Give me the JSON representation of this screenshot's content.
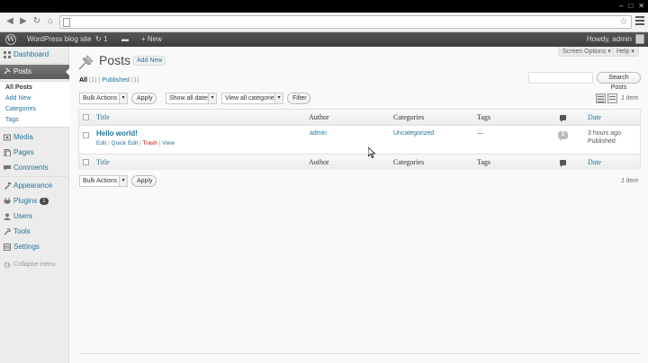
{
  "browser": {
    "back_icon": "arrow-left-icon",
    "forward_icon": "arrow-right-icon",
    "reload_icon": "reload-icon",
    "home_icon": "home-icon",
    "star_icon": "star-icon",
    "menu_icon": "hamburger-icon"
  },
  "adminbar": {
    "site_name": "WordPress blog site",
    "updates_count": "1",
    "new_label": "+ New",
    "howdy": "Howdy, admin"
  },
  "sidebar": {
    "dashboard": "Dashboard",
    "posts": "Posts",
    "submenu": {
      "all_posts": "All Posts",
      "add_new": "Add New",
      "categories": "Categories",
      "tags": "Tags"
    },
    "media": "Media",
    "pages": "Pages",
    "comments": "Comments",
    "appearance": "Appearance",
    "plugins": "Plugins",
    "plugins_badge": "1",
    "users": "Users",
    "tools": "Tools",
    "settings": "Settings",
    "collapse": "Collapse menu"
  },
  "main": {
    "screen_options": "Screen Options ▾",
    "help": "Help ▾",
    "title": "Posts",
    "add_new": "Add New",
    "filters": {
      "all": "All",
      "all_count": "(1)",
      "sep": "|",
      "published": "Published",
      "published_count": "(1)"
    },
    "search_button": "Search Posts",
    "bulk_actions": "Bulk Actions",
    "apply": "Apply",
    "all_dates": "Show all dates",
    "all_categories": "View all categories",
    "filter": "Filter",
    "items_count": "1 item"
  },
  "table": {
    "headers": {
      "title": "Title",
      "author": "Author",
      "categories": "Categories",
      "tags": "Tags",
      "date": "Date"
    },
    "rows": [
      {
        "title": "Hello world!",
        "actions": {
          "edit": "Edit",
          "sep": "|",
          "quick_edit": "Quick Edit",
          "trash": "Trash",
          "view": "View"
        },
        "author": "admin",
        "categories": "Uncategorized",
        "tags": "—",
        "comments": "2",
        "date": "3 hours ago",
        "status": "Published"
      }
    ]
  },
  "colors": {
    "link": "#21759b",
    "adminbar": "#464646",
    "trash": "#bc0b0b"
  }
}
